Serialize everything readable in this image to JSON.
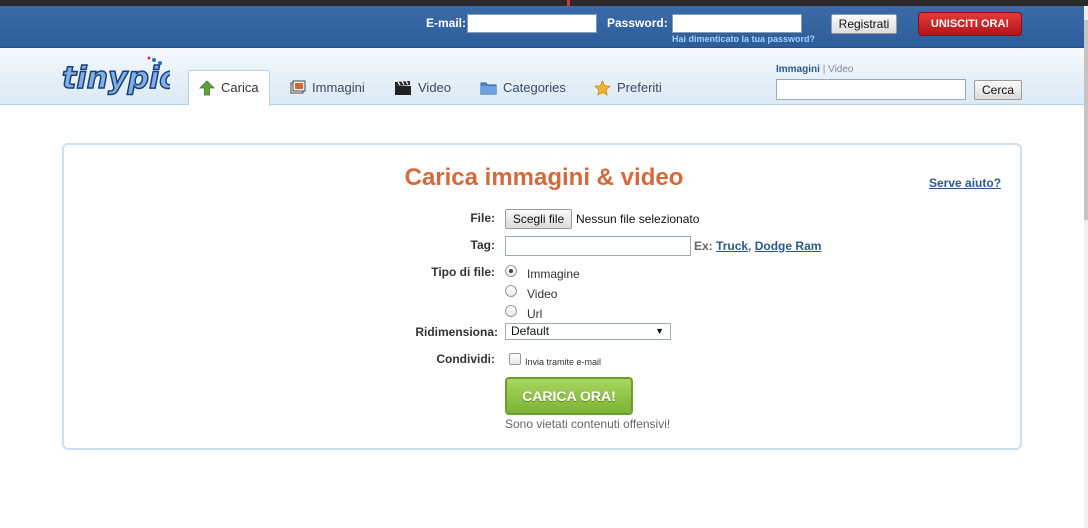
{
  "header": {
    "email_label": "E-mail:",
    "password_label": "Password:",
    "forgot_password": "Hai dimenticato la tua password?",
    "register_button": "Registrati",
    "join_button": "UNISCITI ORA!"
  },
  "nav": {
    "logo_text": "tinypic",
    "tabs": [
      {
        "label": "Carica",
        "icon": "upload-arrow-icon",
        "active": true
      },
      {
        "label": "Immagini",
        "icon": "images-icon",
        "active": false
      },
      {
        "label": "Video",
        "icon": "film-clapper-icon",
        "active": false
      },
      {
        "label": "Categories",
        "icon": "folder-icon",
        "active": false
      },
      {
        "label": "Preferiti",
        "icon": "star-icon",
        "active": false
      }
    ],
    "search_scope": {
      "images": "Immagini",
      "separator": "|",
      "video": "Video"
    },
    "search_value": "",
    "search_button": "Cerca"
  },
  "upload": {
    "title": "Carica immagini & video",
    "help_link": "Serve aiuto?",
    "file_label": "File:",
    "file_button": "Scegli file",
    "file_status": "Nessun file selezionato",
    "tag_label": "Tag:",
    "tag_value": "",
    "tag_example_prefix": "Ex:",
    "tag_example_1": "Truck",
    "tag_example_sep": ",",
    "tag_example_2": "Dodge Ram",
    "file_type_label": "Tipo di file:",
    "file_types": [
      {
        "label": "Immagine",
        "checked": true
      },
      {
        "label": "Video",
        "checked": false
      },
      {
        "label": "Url",
        "checked": false
      }
    ],
    "resize_label": "Ridimensiona:",
    "resize_value": "Default",
    "share_label": "Condividi:",
    "share_option": "Invia tramite e-mail",
    "submit_button": "CARICA ORA!",
    "note": "Sono vietati contenuti offensivi!"
  },
  "colors": {
    "header_blue": "#2d5d9a",
    "title_orange": "#d46a3c",
    "submit_green": "#7bb336",
    "join_red": "#c4201f"
  }
}
